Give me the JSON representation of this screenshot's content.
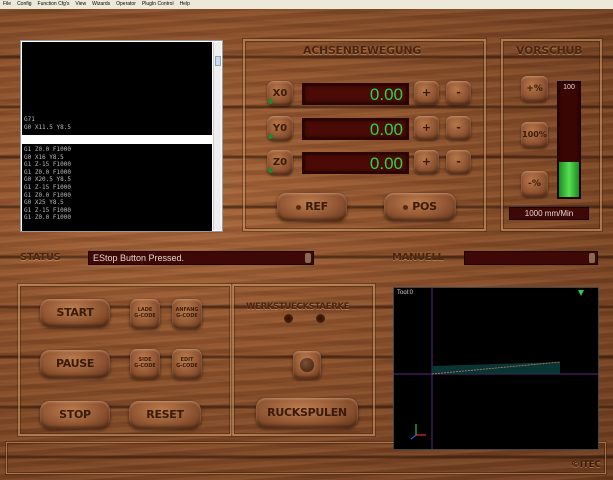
{
  "menu": [
    "File",
    "Config",
    "Function Cfg's",
    "View",
    "Wizards",
    "Operator",
    "PlugIn Control",
    "Help"
  ],
  "gcode": {
    "current_lines": [
      "G71",
      "G0 X11.5 Y8.5"
    ],
    "next_lines": [
      "G1 Z0.0 F1000",
      "G0 X16 Y8.5",
      "G1 Z-15 F1000",
      "G1 Z0.0 F1000",
      "G0 X20.5 Y8.5",
      "G1 Z-15 F1000",
      "G1 Z0.0 F1000",
      "G0 X25 Y8.5",
      "G1 Z-15 F1000",
      "G1 Z0.0 F1000"
    ]
  },
  "axes": {
    "title": "ACHSENBEWEGUNG",
    "rows": [
      {
        "label": "X0",
        "value": "0.00"
      },
      {
        "label": "Y0",
        "value": "0.00"
      },
      {
        "label": "Z0",
        "value": "0.00"
      }
    ],
    "plus": "+",
    "minus": "-",
    "ref_label": "REF",
    "pos_label": "POS"
  },
  "feed": {
    "title": "VORSCHUB",
    "value_top": "100",
    "pct_plus": "+%",
    "pct_100": "100%",
    "pct_minus": "-%",
    "level": 0.3,
    "rate": "1000 mm/Min"
  },
  "status": {
    "label": "STATUS",
    "text": "EStop Button Pressed.",
    "manual_label": "MANUELL",
    "manual_text": ""
  },
  "controls": {
    "start": "START",
    "pause": "PAUSE",
    "stop": "STOP",
    "reset": "RESET",
    "load_gcode": [
      "LADE",
      "G-CODE"
    ],
    "edit_gcode_top": [
      "ANFANG",
      "G-CODE"
    ],
    "edit_gcode": [
      "EDIT",
      "G-CODE"
    ],
    "hide_gcode": [
      "SIDE",
      "G-CODE"
    ]
  },
  "mid": {
    "title": "WERKSTUECKSTAERKE",
    "back_label": "RUCKSPULEN"
  },
  "toolpath": {
    "label": "Tool:0"
  },
  "brand": "©ITEC",
  "colors": {
    "dro_text": "#2bd44a",
    "feed_bar": "#3ecf3a"
  }
}
